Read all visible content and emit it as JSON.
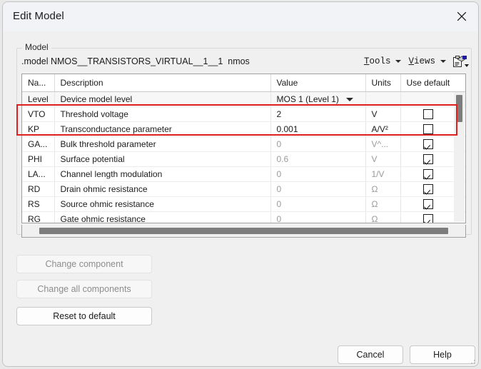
{
  "window": {
    "title": "Edit Model",
    "close_icon": "close-icon"
  },
  "group": {
    "label": "Model",
    "model_line": ".model NMOS__TRANSISTORS_VIRTUAL__1__1  nmos"
  },
  "menubar": {
    "tools": {
      "mnemonic": "T",
      "rest": "ools"
    },
    "views": {
      "mnemonic": "V",
      "rest": "iews"
    },
    "tool_icon": "clipboard-properties-icon"
  },
  "table": {
    "columns": [
      "Na...",
      "Description",
      "Value",
      "Units",
      "Use default"
    ],
    "rows": [
      {
        "name": "Level",
        "description": "Device model level",
        "value": "MOS 1 (Level 1)",
        "units": "",
        "use_default": null,
        "dropdown": true,
        "dim": false
      },
      {
        "name": "VTO",
        "description": "Threshold voltage",
        "value": "2",
        "units": "V",
        "use_default": false,
        "dropdown": false,
        "dim": false
      },
      {
        "name": "KP",
        "description": "Transconductance parameter",
        "value": "0.001",
        "units": "A/V²",
        "use_default": false,
        "dropdown": false,
        "dim": false
      },
      {
        "name": "GA...",
        "description": "Bulk threshold parameter",
        "value": "0",
        "units": "V^...",
        "use_default": true,
        "dropdown": false,
        "dim": true
      },
      {
        "name": "PHI",
        "description": "Surface potential",
        "value": "0.6",
        "units": "V",
        "use_default": true,
        "dropdown": false,
        "dim": true
      },
      {
        "name": "LA...",
        "description": "Channel length modulation",
        "value": "0",
        "units": "1/V",
        "use_default": true,
        "dropdown": false,
        "dim": true
      },
      {
        "name": "RD",
        "description": "Drain ohmic resistance",
        "value": "0",
        "units": "Ω",
        "use_default": true,
        "dropdown": false,
        "dim": true
      },
      {
        "name": "RS",
        "description": "Source ohmic resistance",
        "value": "0",
        "units": "Ω",
        "use_default": true,
        "dropdown": false,
        "dim": true
      },
      {
        "name": "RG",
        "description": "Gate ohmic resistance",
        "value": "0",
        "units": "Ω",
        "use_default": true,
        "dropdown": false,
        "dim": true
      }
    ]
  },
  "buttons": {
    "change_component": "Change component",
    "change_all_components": "Change all components",
    "reset_to_default": "Reset to default",
    "cancel": "Cancel",
    "help": "Help"
  },
  "annotation": {
    "highlight_color": "#e01f1f"
  }
}
